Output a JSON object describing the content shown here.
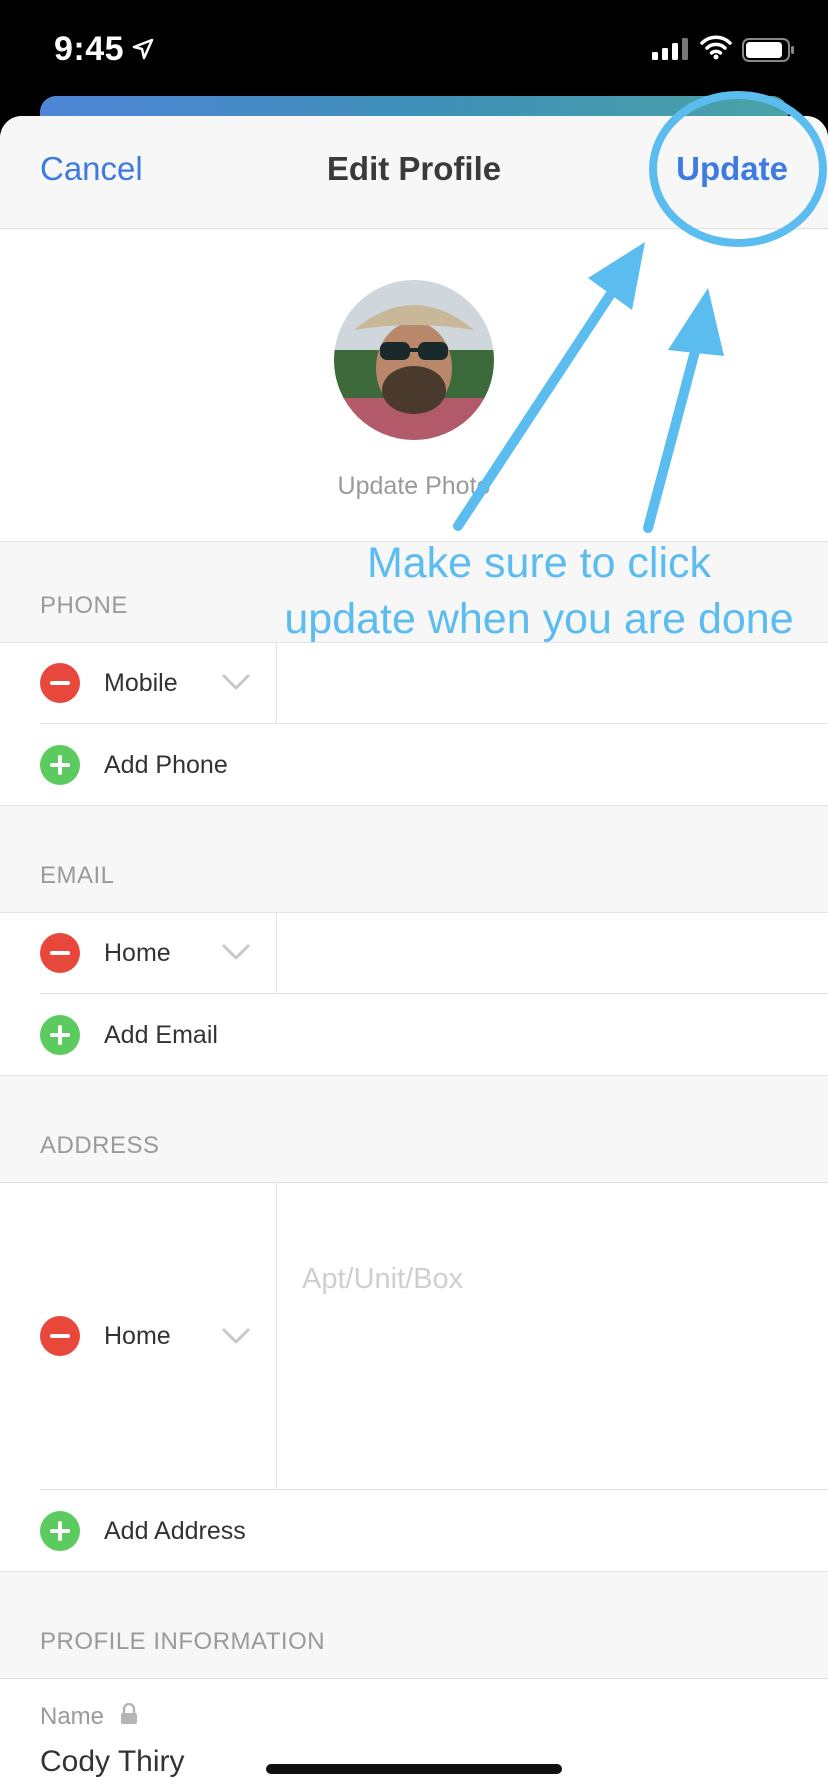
{
  "status_bar": {
    "time": "9:45",
    "icons": [
      "location-arrow-icon",
      "cellular-signal-icon",
      "wifi-icon",
      "battery-icon"
    ]
  },
  "nav": {
    "cancel_label": "Cancel",
    "title": "Edit Profile",
    "update_label": "Update"
  },
  "profile": {
    "update_photo_label": "Update Photo"
  },
  "phone": {
    "header": "PHONE",
    "items": [
      {
        "type": "Mobile"
      }
    ],
    "add_label": "Add Phone"
  },
  "email": {
    "header": "EMAIL",
    "items": [
      {
        "type": "Home"
      }
    ],
    "add_label": "Add Email"
  },
  "address": {
    "header": "ADDRESS",
    "items": [
      {
        "type": "Home",
        "placeholder": "Apt/Unit/Box"
      }
    ],
    "add_label": "Add Address"
  },
  "profile_info": {
    "header": "PROFILE INFORMATION",
    "name_label": "Name",
    "name_value": "Cody Thiry"
  },
  "annotation": {
    "line1": "Make sure to click",
    "line2": "update when you are done",
    "color": "#5bbcf0"
  },
  "colors": {
    "accent": "#3d7be0",
    "remove": "#e8473c",
    "add": "#5ccb5f"
  }
}
